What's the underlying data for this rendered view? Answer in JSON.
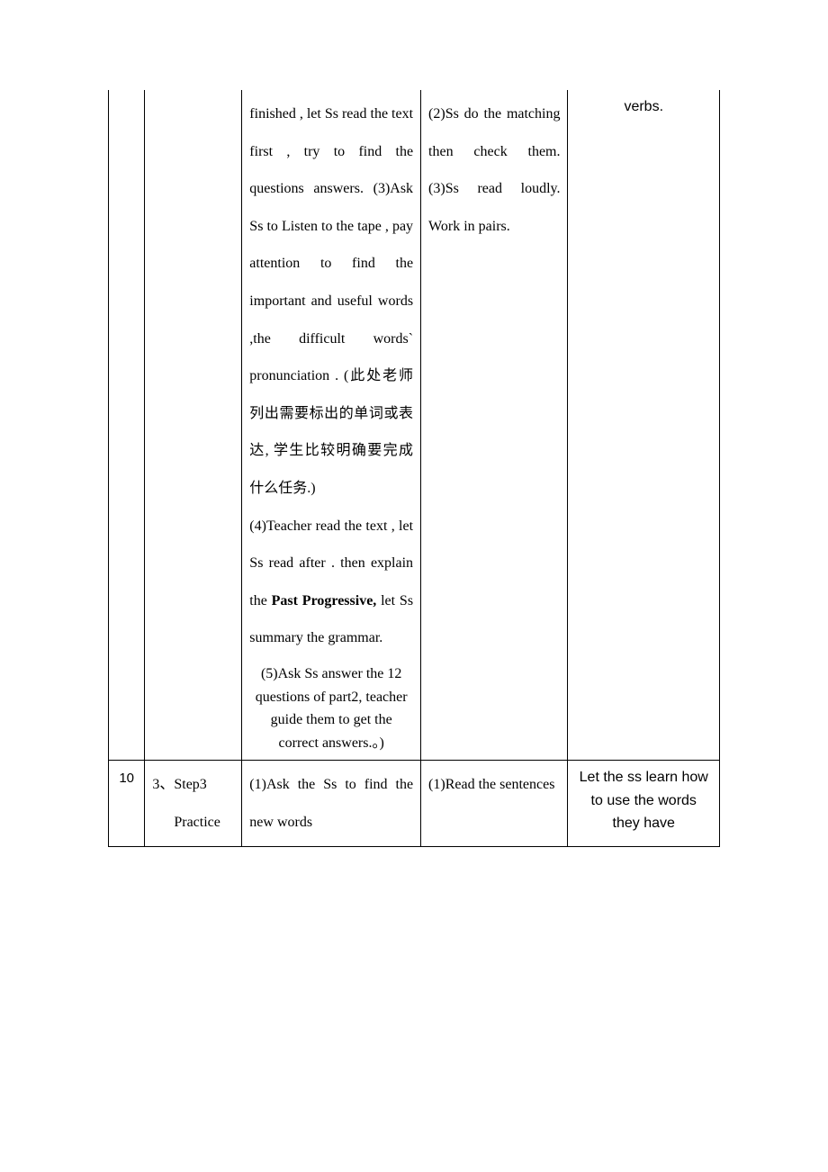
{
  "row1": {
    "col1": "",
    "col2": "",
    "col3_part1": "finished , let Ss read the text first , try to find the questions answers. (3)Ask Ss to Listen to the tape , pay attention to find the important and useful words ,the difficult words` pronunciation . (此处老师列出需要标出的单词或表达, 学生比较明确要完成什么任务.)",
    "col3_part2a": "(4)Teacher read the text , let Ss read after .  then explain the ",
    "col3_bold1": "Past Progressive,",
    "col3_part2b": " let Ss summary the grammar.",
    "col3_part3": " (5)Ask Ss answer the 12 questions of part2, teacher guide them to get the correct answers.。)",
    "col4": "(2)Ss do the matching then check them. (3)Ss read loudly. Work in pairs.",
    "col5": "verbs."
  },
  "row2": {
    "col1": "10",
    "col2_line1": "3、Step3",
    "col2_line2": "Practice",
    "col3": "(1)Ask the Ss to find the new words",
    "col4": "(1)Read the sentences",
    "col5": "Let the ss learn how to use the words they have"
  }
}
